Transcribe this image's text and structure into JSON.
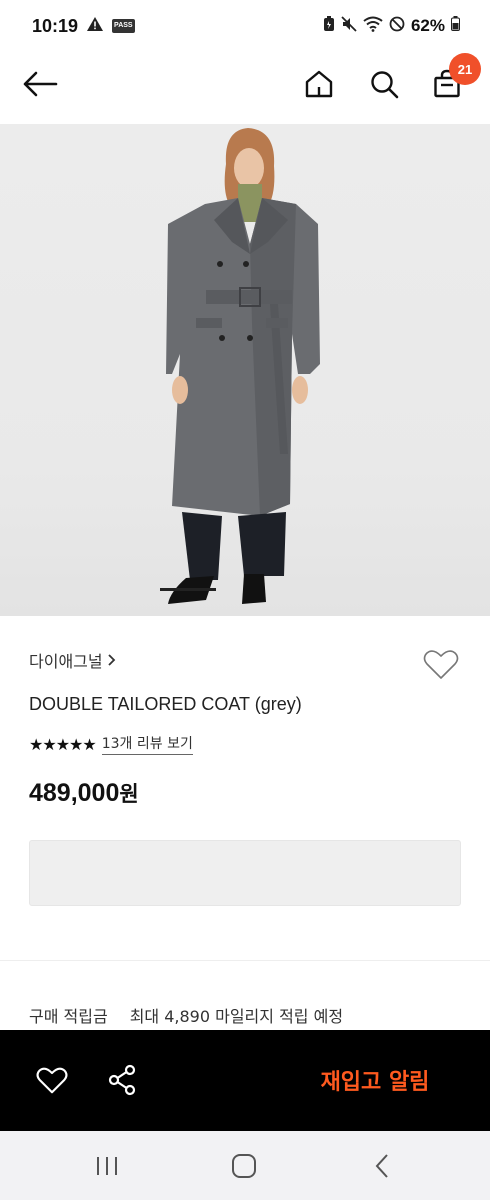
{
  "status_bar": {
    "time": "10:19",
    "pass_label": "PASS",
    "battery": "62%"
  },
  "header": {
    "cart_count": "21"
  },
  "product": {
    "brand": "다이애그널",
    "name": "DOUBLE TAILORED COAT (grey)",
    "rating_stars": 5,
    "review_link": "13개 리뷰 보기",
    "price_number": "489,000",
    "price_unit": "원"
  },
  "points": {
    "label": "구매 적립금",
    "value": "최대 4,890 마일리지 적립 예정"
  },
  "action_bar": {
    "restock_label": "재입고 알림"
  },
  "colors": {
    "accent": "#ff5a1f",
    "badge": "#f0502a",
    "action_bar_bg": "#000000"
  }
}
